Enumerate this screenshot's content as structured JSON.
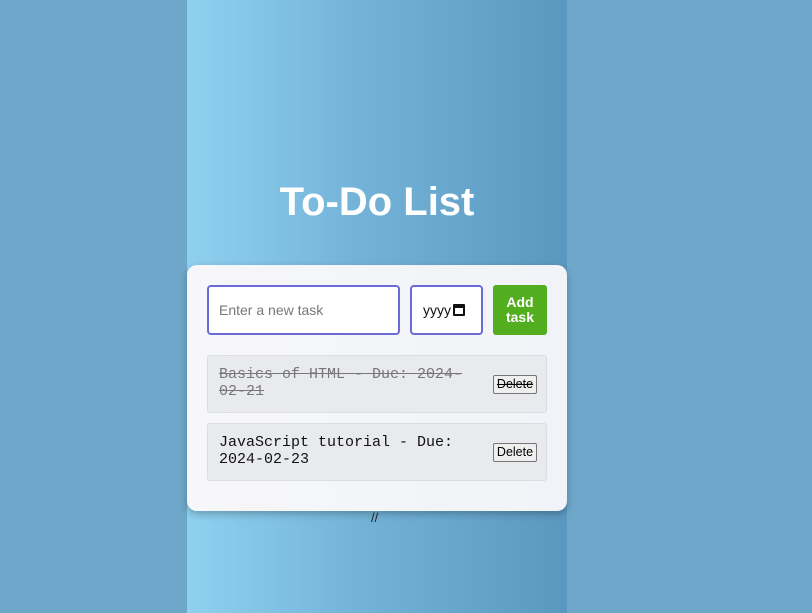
{
  "page": {
    "title": "To-Do List",
    "footer_mark": "//"
  },
  "form": {
    "task_placeholder": "Enter a new task",
    "task_value": "",
    "date_placeholder": "yyyy",
    "add_label": "Add task"
  },
  "tasks": [
    {
      "text": "Basics of HTML - Due: 2024-02-21",
      "completed": true,
      "delete_label": "Delete"
    },
    {
      "text": "JavaScript tutorial - Due: 2024-02-23",
      "completed": false,
      "delete_label": "Delete"
    }
  ],
  "colors": {
    "accent_border": "#6b6bd8",
    "add_button": "#52ad1f",
    "background": "#6ea7ca"
  },
  "icons": {
    "date_picker": "calendar-icon"
  }
}
